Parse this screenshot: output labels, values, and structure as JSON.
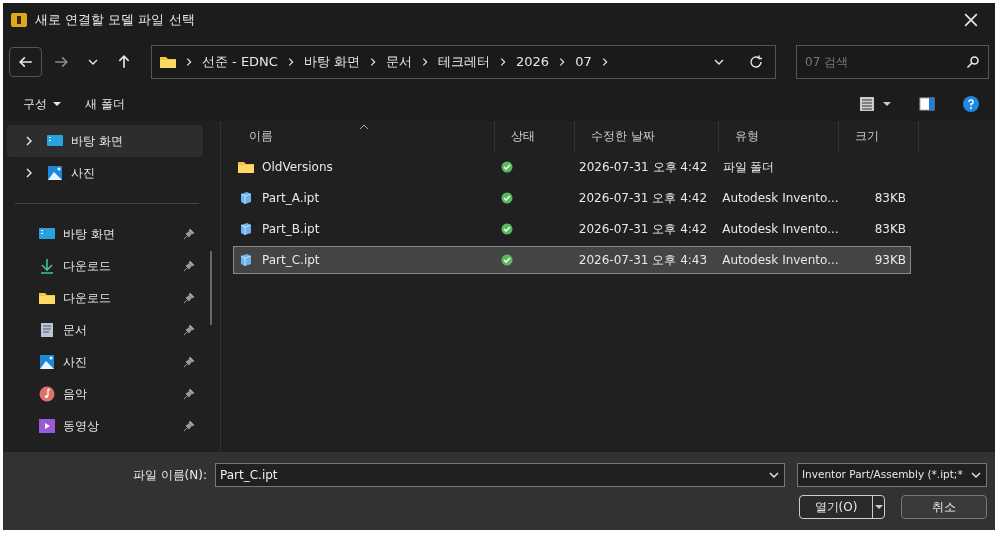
{
  "window": {
    "title": "새로 연결할 모델 파일 선택"
  },
  "breadcrumb": [
    "선준 - EDNC",
    "바탕 화면",
    "문서",
    "테크레터",
    "2026",
    "07"
  ],
  "search": {
    "placeholder": "07 검색"
  },
  "commands": [
    {
      "label": "구성",
      "dropdown": true
    },
    {
      "label": "새 폴더",
      "dropdown": false
    }
  ],
  "sidebar": {
    "tree": [
      {
        "label": "바탕 화면",
        "kind": "desktop",
        "selected": true
      },
      {
        "label": "사진",
        "kind": "pictures",
        "selected": false
      }
    ],
    "quick_access": [
      {
        "label": "바탕 화면",
        "kind": "desktop",
        "selected": false
      },
      {
        "label": "다운로드",
        "kind": "download",
        "selected": false
      },
      {
        "label": "다운로드",
        "kind": "folder",
        "selected": false
      },
      {
        "label": "문서",
        "kind": "document",
        "selected": false
      },
      {
        "label": "사진",
        "kind": "pictures",
        "selected": false
      },
      {
        "label": "음악",
        "kind": "music",
        "selected": false
      },
      {
        "label": "동영상",
        "kind": "video",
        "selected": false
      }
    ]
  },
  "table": {
    "columns": [
      {
        "label": "이름",
        "sorted": true
      },
      {
        "label": "상태",
        "sorted": false
      },
      {
        "label": "수정한 날짜",
        "sorted": false
      },
      {
        "label": "유형",
        "sorted": false
      },
      {
        "label": "크기",
        "sorted": false
      }
    ],
    "rows": [
      {
        "name": "OldVersions",
        "kind": "folder",
        "date": "2026-07-31 오후 4:42",
        "type": "파일 폴더",
        "size": "",
        "selected": false
      },
      {
        "name": "Part_A.ipt",
        "kind": "part",
        "date": "2026-07-31 오후 4:42",
        "type": "Autodesk Invento...",
        "size": "83KB",
        "selected": false
      },
      {
        "name": "Part_B.ipt",
        "kind": "part",
        "date": "2026-07-31 오후 4:42",
        "type": "Autodesk Invento...",
        "size": "83KB",
        "selected": false
      },
      {
        "name": "Part_C.ipt",
        "kind": "part",
        "date": "2026-07-31 오후 4:43",
        "type": "Autodesk Invento...",
        "size": "93KB",
        "selected": true
      }
    ]
  },
  "footer": {
    "filename_label": "파일 이름(N):",
    "filename": "Part_C.ipt",
    "filter": "Inventor Part/Assembly (*.ipt;*",
    "open": "열기(O)",
    "cancel": "취소"
  }
}
